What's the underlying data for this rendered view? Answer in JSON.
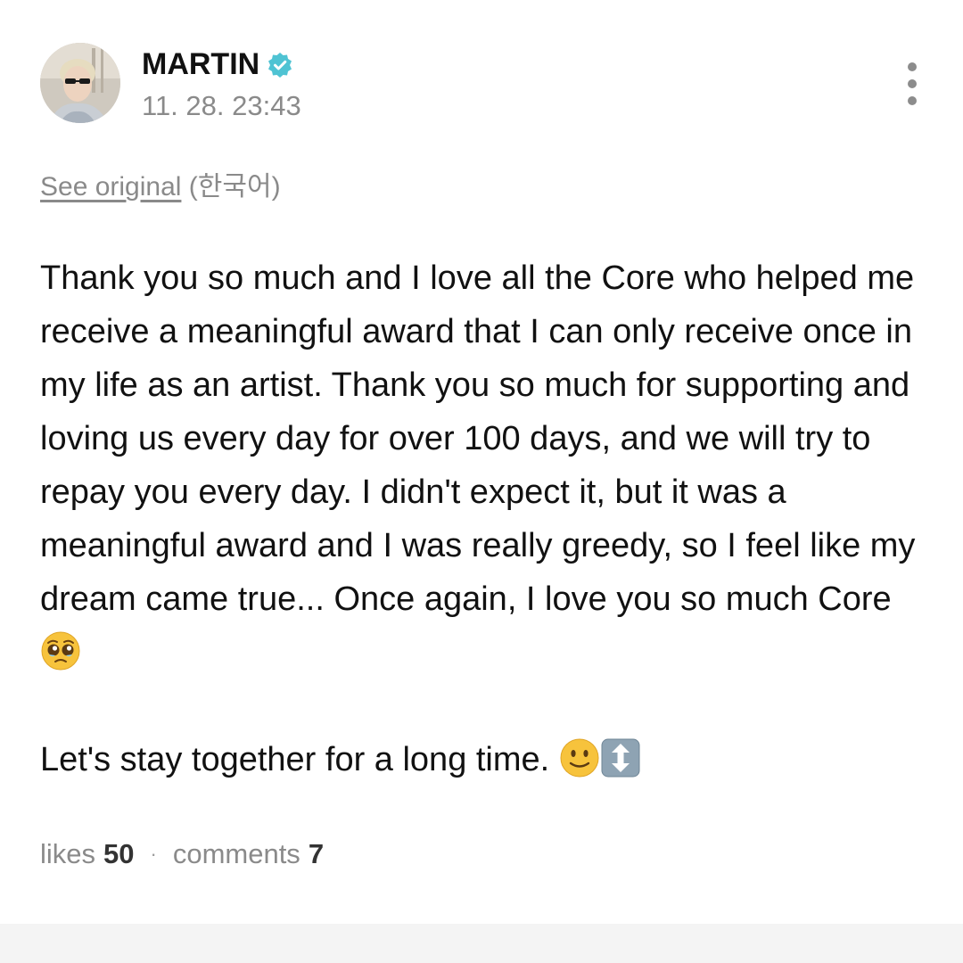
{
  "post": {
    "author": "MARTIN",
    "verified": true,
    "timestamp": "11. 28. 23:43",
    "translation": {
      "link_label": "See original",
      "language_note": "(한국어)"
    },
    "paragraphs": [
      "Thank you so much and I love all the Core who helped me receive a meaningful award that I can only receive once in my life as an artist. Thank you so much for supporting and loving us every day for over 100 days, and we will try to repay you every day. I didn't expect it, but it was a meaningful award and I was really greedy, so I feel like my dream came true... Once again, I love you so much Core",
      "Let's stay together for a long time."
    ],
    "emojis": [
      "pleading-face-emoji",
      "slightly-smiling-face-emoji",
      "up-down-arrow-emoji"
    ],
    "stats": {
      "likes_label": "likes",
      "likes_count": "50",
      "separator": "·",
      "comments_label": "comments",
      "comments_count": "7"
    }
  },
  "icons": {
    "verified": "verified-badge-icon",
    "menu": "more-vertical-icon"
  },
  "colors": {
    "verified_badge": "#4fc3d3",
    "secondary_text": "#8a8a8a",
    "primary_text": "#111111",
    "bottom_strip": "#f4f4f4"
  }
}
